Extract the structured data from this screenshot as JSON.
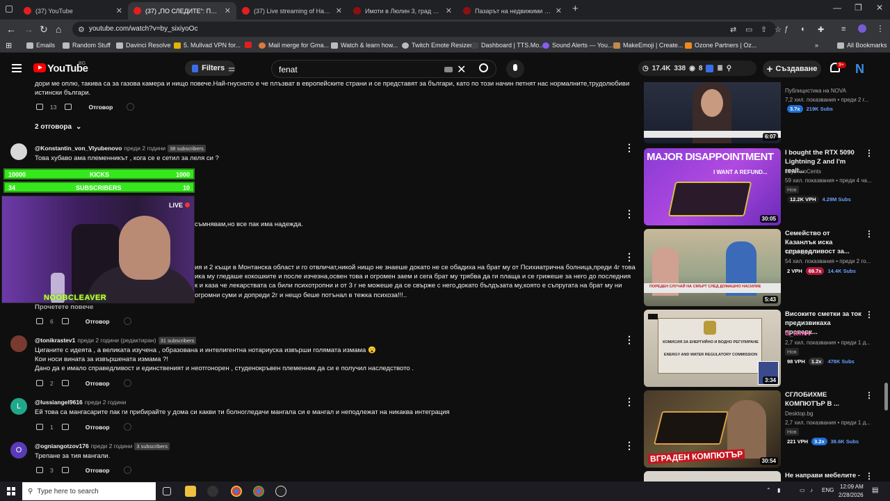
{
  "browser": {
    "tabs": [
      {
        "label": "(37) YouTube"
      },
      {
        "label": "(37) „ПО СЛЕДИТЕ“: Пенсионер"
      },
      {
        "label": "(37) Live streaming of Натурал"
      },
      {
        "label": "Имоти в Люлин 3, град София"
      },
      {
        "label": "Пазарът на недвижими имоти"
      }
    ],
    "url": "youtube.com/watch?v=by_sixiyoOc",
    "bookmarks": [
      "Emails",
      "Random Stuff",
      "Davinci Resolve",
      "5. Mullvad VPN for...",
      "Mail merge for Gma...",
      "Watch & learn how...",
      "Twitch Emote Resizer",
      "Dashboard | TTS.Mo...",
      "Sound Alerts — You...",
      "MakeEmoji | Create...",
      "Ozone Partners | Oz..."
    ],
    "all_bookmarks": "All Bookmarks"
  },
  "youtube": {
    "logo_text": "YouTube",
    "country": "BG",
    "filters_label": "Filters",
    "search_value": "fenat",
    "ext_stats": {
      "views": "17.4K",
      "a": "338",
      "b": "8"
    },
    "create_label": "Създаване",
    "notif_badge": "9+",
    "avatar_letter": "N"
  },
  "comments": {
    "top_text_1": "дори ме оплю, такива са за газова камера и нищо повече.Най-гнусното е че плъзват в европейските страни и се представят за българи, като по този начин петнят нас нормалните,трудолюбиви",
    "top_text_2": "истински българи.",
    "top_likes": "13",
    "reply_label": "Отговор",
    "replies_toggle": "2 отговора",
    "c1": {
      "author": "@Konstantin_von_Vlyubenovo",
      "date": "преди 2 години",
      "subs": "38 subscribers",
      "text": "Това хубаво ама племенникът , кога се е сетил за леля си ?"
    },
    "c2_text": "съмнявам,но  все пак има надежда.",
    "c3_lines": [
      "ия и 2 къщи в Монтанска област и го отвличат,никой нищо не знаеше докато не се обадиха на брат му от Психиатрична болница,преди 4г това",
      "ика му гледаше кокошките и после изчезна,освен това и огромен заем и сега брат му трябва да ги плаща и се грижеше за него до последния",
      "к и каза че лекарствата са били психотропни и от 3 г не можеше да се свърже с него,докато бълдъзата му,която е съпругата на брат  му ни",
      "огромни суми и допреди 2г и нещо беше потънал в тежка психоза!!!.."
    ],
    "read_more": "Прочетете повече",
    "c3_likes": "6",
    "c4": {
      "author": "@tonikrastev1",
      "date": "преди 2 години (редактиран)",
      "subs": "31 subscribers",
      "lines": [
        "Циганите с идеята , а великата изучена , образована и интелигентна нотариуска извърши голямата измама 😮",
        "Кои носи вината за извършената измама ?!",
        "Дано да е имало справедливост и единственият и неотгонорен , студенокръвен племенник да си е получил наследството ."
      ],
      "likes": "2"
    },
    "c5": {
      "author": "@lussiangel9616",
      "date": "преди 2 години",
      "avatar_letter": "L",
      "text": "Ей това са мангасарите пак ги прибирайте у дома си какви ти болногледачи мангала си е мангал и неподлежат на никаква интеграция",
      "likes": "1"
    },
    "c6": {
      "author": "@ogniangotzov176",
      "date": "преди 2 години",
      "subs": "3 subscribers",
      "avatar_letter": "O",
      "text": "Трепане за тия мангали.",
      "likes": "3"
    }
  },
  "overlay": {
    "kicks": {
      "left": "10000",
      "label": "KICKS",
      "right": "1000"
    },
    "subs": {
      "left": "34",
      "label": "SUBSCRIBERS",
      "right": "10"
    },
    "live": "LIVE",
    "name": "NOOBCLEAVER"
  },
  "sidebar": {
    "v0": {
      "meta1": "Публицистика на NOVA",
      "meta2": "7,2 хил. показвания • преди 2 г...",
      "s1": "3.7x",
      "s2": "219K Subs",
      "dur": "6:07"
    },
    "v1": {
      "title": "I bought the RTX 5090 Lightning Z and I'm reall...",
      "channel": "JayzTwoCents",
      "meta": "59 хил. показвания • преди 4 ча...",
      "new": "Нов",
      "s1": "12.2K VPH",
      "s2": "4.29M Subs",
      "dur": "30:05",
      "thumb_text": "MAJOR DISAPPOINTMENT",
      "thumb_sub": "I WANT A REFUND..."
    },
    "v2": {
      "title": "Семейство от Казанлък иска справедливост за...",
      "channel": "Твоят ден",
      "meta": "54 хил. показвания • преди 2 го...",
      "s0": "2 VPH",
      "s1": "69.7x",
      "s2": "14.4K Subs",
      "dur": "5:43",
      "banner": "ПОРЕДЕН СЛУЧАЙ НА СМЪРТ СЛЕД ДОМАШНО НАСИЛИЕ"
    },
    "v3": {
      "title": "Високите сметки за ток предизвикаха проверк...",
      "channel": "d_tenev",
      "meta": "2,7 хил. показвания • преди 1 д...",
      "new": "Нов",
      "s0": "98 VPH",
      "s1": "1.2x",
      "s2": "478K Subs",
      "dur": "3:34",
      "sign1": "КОМИСИЯ ЗА ЕНЕРГИЙНО И ВОДНО РЕГУЛИРАНЕ",
      "sign2": "ENERGY AND WATER REGULATORY COMMISSION"
    },
    "v4": {
      "title": "СГЛОБИХМЕ КОМПЮТЪР В ...",
      "channel": "Desktop.bg",
      "meta": "2,7 хил. показвания • преди 1 д...",
      "new": "Нов",
      "s0": "221 VPH",
      "s1": "3.2x",
      "s2": "38.6K Subs",
      "dur": "30:54",
      "thumb_text": "ВГРАДЕН КОМПЮТЪР"
    },
    "v5": {
      "title": "Не направи мебелите -"
    }
  },
  "taskbar": {
    "search_placeholder": "Type here to search",
    "lang": "ENG",
    "time": "12:09 AM",
    "date": "2/28/2026"
  }
}
